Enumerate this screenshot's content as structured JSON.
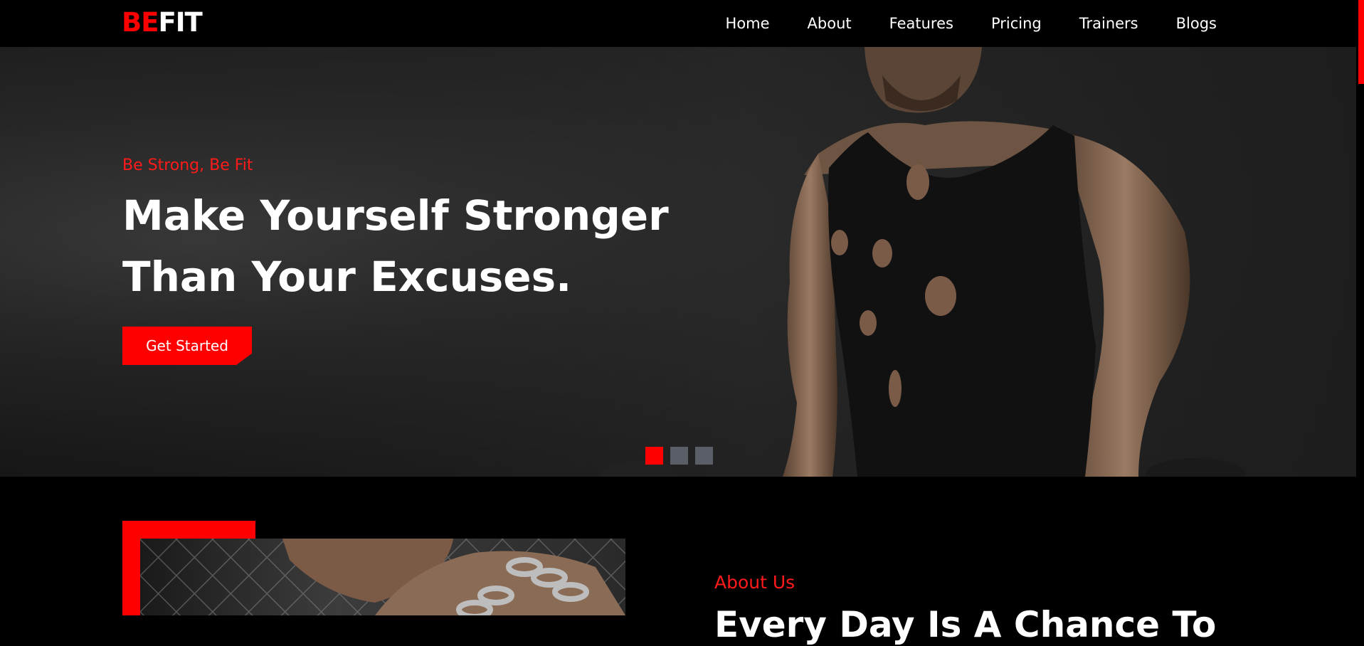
{
  "brand": {
    "accent": "BE",
    "rest": "FIT",
    "accent_color": "#ff0000"
  },
  "nav": {
    "items": [
      "Home",
      "About",
      "Features",
      "Pricing",
      "Trainers",
      "Blogs"
    ]
  },
  "hero": {
    "tagline": "Be Strong, Be Fit",
    "headline_line1": "Make Yourself Stronger",
    "headline_line2": "Than Your Excuses.",
    "cta_label": "Get Started",
    "slides": 3,
    "active_slide": 1
  },
  "about": {
    "label": "About Us",
    "heading": "Every Day Is A Chance To"
  }
}
